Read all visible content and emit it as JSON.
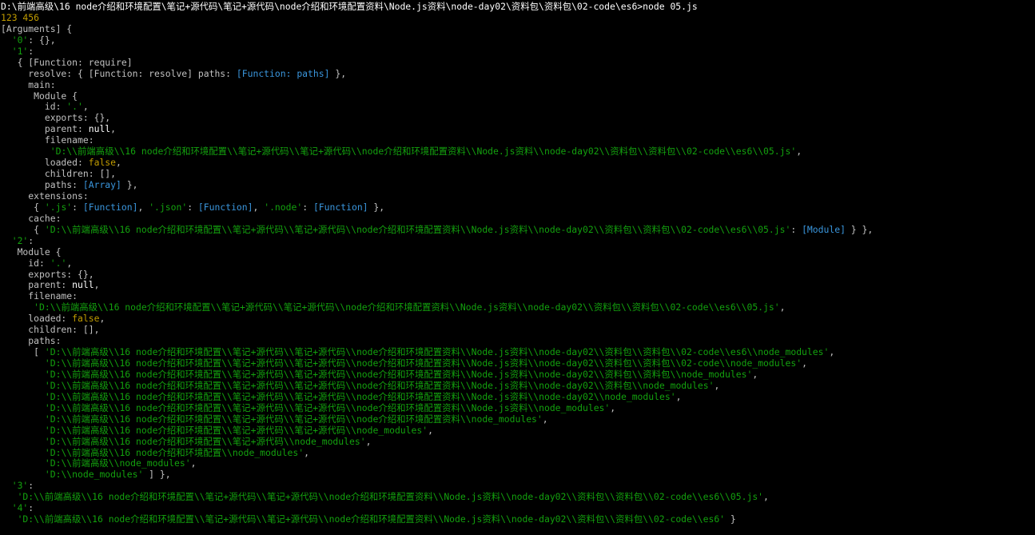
{
  "window": {
    "title": "node 05.js console output"
  },
  "colors": {
    "background": "#000000",
    "default": "#c0c0c0",
    "white": "#ffffff",
    "string": "#13a10e",
    "function": "#3a96dd",
    "number": "#c19c00",
    "keyword": "#c19c00"
  },
  "lines": [
    [
      {
        "t": "D:\\前端高级\\16 node介绍和环境配置\\笔记+源代码\\笔记+源代码\\node介绍和环境配置资料\\Node.js资料\\node-day02\\资料包\\资料包\\02-code\\es6>node 05.js",
        "c": "wht"
      }
    ],
    [
      {
        "t": "123 456",
        "c": "num"
      }
    ],
    [
      {
        "t": "[Arguments] {",
        "c": "def"
      }
    ],
    [
      {
        "t": "  ",
        "c": "def"
      },
      {
        "t": "'0'",
        "c": "str"
      },
      {
        "t": ": {},",
        "c": "def"
      }
    ],
    [
      {
        "t": "  ",
        "c": "def"
      },
      {
        "t": "'1'",
        "c": "str"
      },
      {
        "t": ":",
        "c": "def"
      }
    ],
    [
      {
        "t": "   { [Function: require]",
        "c": "def"
      }
    ],
    [
      {
        "t": "     resolve: { [Function: resolve] paths: ",
        "c": "def"
      },
      {
        "t": "[Function: paths]",
        "c": "fn"
      },
      {
        "t": " },",
        "c": "def"
      }
    ],
    [
      {
        "t": "     main:",
        "c": "def"
      }
    ],
    [
      {
        "t": "      Module {",
        "c": "def"
      }
    ],
    [
      {
        "t": "        id: ",
        "c": "def"
      },
      {
        "t": "'.'",
        "c": "str"
      },
      {
        "t": ",",
        "c": "def"
      }
    ],
    [
      {
        "t": "        exports: {},",
        "c": "def"
      }
    ],
    [
      {
        "t": "        parent: ",
        "c": "def"
      },
      {
        "t": "null",
        "c": "wht"
      },
      {
        "t": ",",
        "c": "def"
      }
    ],
    [
      {
        "t": "        filename:",
        "c": "def"
      }
    ],
    [
      {
        "t": "         ",
        "c": "def"
      },
      {
        "t": "'D:\\\\前端高级\\\\16 node介绍和环境配置\\\\笔记+源代码\\\\笔记+源代码\\\\node介绍和环境配置资料\\\\Node.js资料\\\\node-day02\\\\资料包\\\\资料包\\\\02-code\\\\es6\\\\05.js'",
        "c": "str"
      },
      {
        "t": ",",
        "c": "def"
      }
    ],
    [
      {
        "t": "        loaded: ",
        "c": "def"
      },
      {
        "t": "false",
        "c": "kw"
      },
      {
        "t": ",",
        "c": "def"
      }
    ],
    [
      {
        "t": "        children: [],",
        "c": "def"
      }
    ],
    [
      {
        "t": "        paths: ",
        "c": "def"
      },
      {
        "t": "[Array]",
        "c": "fn"
      },
      {
        "t": " },",
        "c": "def"
      }
    ],
    [
      {
        "t": "     extensions:",
        "c": "def"
      }
    ],
    [
      {
        "t": "      { ",
        "c": "def"
      },
      {
        "t": "'.js'",
        "c": "str"
      },
      {
        "t": ": ",
        "c": "def"
      },
      {
        "t": "[Function]",
        "c": "fn"
      },
      {
        "t": ", ",
        "c": "def"
      },
      {
        "t": "'.json'",
        "c": "str"
      },
      {
        "t": ": ",
        "c": "def"
      },
      {
        "t": "[Function]",
        "c": "fn"
      },
      {
        "t": ", ",
        "c": "def"
      },
      {
        "t": "'.node'",
        "c": "str"
      },
      {
        "t": ": ",
        "c": "def"
      },
      {
        "t": "[Function]",
        "c": "fn"
      },
      {
        "t": " },",
        "c": "def"
      }
    ],
    [
      {
        "t": "     cache:",
        "c": "def"
      }
    ],
    [
      {
        "t": "      { ",
        "c": "def"
      },
      {
        "t": "'D:\\\\前端高级\\\\16 node介绍和环境配置\\\\笔记+源代码\\\\笔记+源代码\\\\node介绍和环境配置资料\\\\Node.js资料\\\\node-day02\\\\资料包\\\\资料包\\\\02-code\\\\es6\\\\05.js'",
        "c": "str"
      },
      {
        "t": ": ",
        "c": "def"
      },
      {
        "t": "[Module]",
        "c": "fn"
      },
      {
        "t": " } },",
        "c": "def"
      }
    ],
    [
      {
        "t": "  ",
        "c": "def"
      },
      {
        "t": "'2'",
        "c": "str"
      },
      {
        "t": ":",
        "c": "def"
      }
    ],
    [
      {
        "t": "   Module {",
        "c": "def"
      }
    ],
    [
      {
        "t": "     id: ",
        "c": "def"
      },
      {
        "t": "'.'",
        "c": "str"
      },
      {
        "t": ",",
        "c": "def"
      }
    ],
    [
      {
        "t": "     exports: {},",
        "c": "def"
      }
    ],
    [
      {
        "t": "     parent: ",
        "c": "def"
      },
      {
        "t": "null",
        "c": "wht"
      },
      {
        "t": ",",
        "c": "def"
      }
    ],
    [
      {
        "t": "     filename:",
        "c": "def"
      }
    ],
    [
      {
        "t": "      ",
        "c": "def"
      },
      {
        "t": "'D:\\\\前端高级\\\\16 node介绍和环境配置\\\\笔记+源代码\\\\笔记+源代码\\\\node介绍和环境配置资料\\\\Node.js资料\\\\node-day02\\\\资料包\\\\资料包\\\\02-code\\\\es6\\\\05.js'",
        "c": "str"
      },
      {
        "t": ",",
        "c": "def"
      }
    ],
    [
      {
        "t": "     loaded: ",
        "c": "def"
      },
      {
        "t": "false",
        "c": "kw"
      },
      {
        "t": ",",
        "c": "def"
      }
    ],
    [
      {
        "t": "     children: [],",
        "c": "def"
      }
    ],
    [
      {
        "t": "     paths:",
        "c": "def"
      }
    ],
    [
      {
        "t": "      [ ",
        "c": "def"
      },
      {
        "t": "'D:\\\\前端高级\\\\16 node介绍和环境配置\\\\笔记+源代码\\\\笔记+源代码\\\\node介绍和环境配置资料\\\\Node.js资料\\\\node-day02\\\\资料包\\\\资料包\\\\02-code\\\\es6\\\\node_modules'",
        "c": "str"
      },
      {
        "t": ",",
        "c": "def"
      }
    ],
    [
      {
        "t": "        ",
        "c": "def"
      },
      {
        "t": "'D:\\\\前端高级\\\\16 node介绍和环境配置\\\\笔记+源代码\\\\笔记+源代码\\\\node介绍和环境配置资料\\\\Node.js资料\\\\node-day02\\\\资料包\\\\资料包\\\\02-code\\\\node_modules'",
        "c": "str"
      },
      {
        "t": ",",
        "c": "def"
      }
    ],
    [
      {
        "t": "        ",
        "c": "def"
      },
      {
        "t": "'D:\\\\前端高级\\\\16 node介绍和环境配置\\\\笔记+源代码\\\\笔记+源代码\\\\node介绍和环境配置资料\\\\Node.js资料\\\\node-day02\\\\资料包\\\\资料包\\\\node_modules'",
        "c": "str"
      },
      {
        "t": ",",
        "c": "def"
      }
    ],
    [
      {
        "t": "        ",
        "c": "def"
      },
      {
        "t": "'D:\\\\前端高级\\\\16 node介绍和环境配置\\\\笔记+源代码\\\\笔记+源代码\\\\node介绍和环境配置资料\\\\Node.js资料\\\\node-day02\\\\资料包\\\\node_modules'",
        "c": "str"
      },
      {
        "t": ",",
        "c": "def"
      }
    ],
    [
      {
        "t": "        ",
        "c": "def"
      },
      {
        "t": "'D:\\\\前端高级\\\\16 node介绍和环境配置\\\\笔记+源代码\\\\笔记+源代码\\\\node介绍和环境配置资料\\\\Node.js资料\\\\node-day02\\\\node_modules'",
        "c": "str"
      },
      {
        "t": ",",
        "c": "def"
      }
    ],
    [
      {
        "t": "        ",
        "c": "def"
      },
      {
        "t": "'D:\\\\前端高级\\\\16 node介绍和环境配置\\\\笔记+源代码\\\\笔记+源代码\\\\node介绍和环境配置资料\\\\Node.js资料\\\\node_modules'",
        "c": "str"
      },
      {
        "t": ",",
        "c": "def"
      }
    ],
    [
      {
        "t": "        ",
        "c": "def"
      },
      {
        "t": "'D:\\\\前端高级\\\\16 node介绍和环境配置\\\\笔记+源代码\\\\笔记+源代码\\\\node介绍和环境配置资料\\\\node_modules'",
        "c": "str"
      },
      {
        "t": ",",
        "c": "def"
      }
    ],
    [
      {
        "t": "        ",
        "c": "def"
      },
      {
        "t": "'D:\\\\前端高级\\\\16 node介绍和环境配置\\\\笔记+源代码\\\\笔记+源代码\\\\node_modules'",
        "c": "str"
      },
      {
        "t": ",",
        "c": "def"
      }
    ],
    [
      {
        "t": "        ",
        "c": "def"
      },
      {
        "t": "'D:\\\\前端高级\\\\16 node介绍和环境配置\\\\笔记+源代码\\\\node_modules'",
        "c": "str"
      },
      {
        "t": ",",
        "c": "def"
      }
    ],
    [
      {
        "t": "        ",
        "c": "def"
      },
      {
        "t": "'D:\\\\前端高级\\\\16 node介绍和环境配置\\\\node_modules'",
        "c": "str"
      },
      {
        "t": ",",
        "c": "def"
      }
    ],
    [
      {
        "t": "        ",
        "c": "def"
      },
      {
        "t": "'D:\\\\前端高级\\\\node_modules'",
        "c": "str"
      },
      {
        "t": ",",
        "c": "def"
      }
    ],
    [
      {
        "t": "        ",
        "c": "def"
      },
      {
        "t": "'D:\\\\node_modules'",
        "c": "str"
      },
      {
        "t": " ] },",
        "c": "def"
      }
    ],
    [
      {
        "t": "  ",
        "c": "def"
      },
      {
        "t": "'3'",
        "c": "str"
      },
      {
        "t": ":",
        "c": "def"
      }
    ],
    [
      {
        "t": "   ",
        "c": "def"
      },
      {
        "t": "'D:\\\\前端高级\\\\16 node介绍和环境配置\\\\笔记+源代码\\\\笔记+源代码\\\\node介绍和环境配置资料\\\\Node.js资料\\\\node-day02\\\\资料包\\\\资料包\\\\02-code\\\\es6\\\\05.js'",
        "c": "str"
      },
      {
        "t": ",",
        "c": "def"
      }
    ],
    [
      {
        "t": "  ",
        "c": "def"
      },
      {
        "t": "'4'",
        "c": "str"
      },
      {
        "t": ":",
        "c": "def"
      }
    ],
    [
      {
        "t": "   ",
        "c": "def"
      },
      {
        "t": "'D:\\\\前端高级\\\\16 node介绍和环境配置\\\\笔记+源代码\\\\笔记+源代码\\\\node介绍和环境配置资料\\\\Node.js资料\\\\node-day02\\\\资料包\\\\资料包\\\\02-code\\\\es6'",
        "c": "str"
      },
      {
        "t": " }",
        "c": "def"
      }
    ]
  ]
}
